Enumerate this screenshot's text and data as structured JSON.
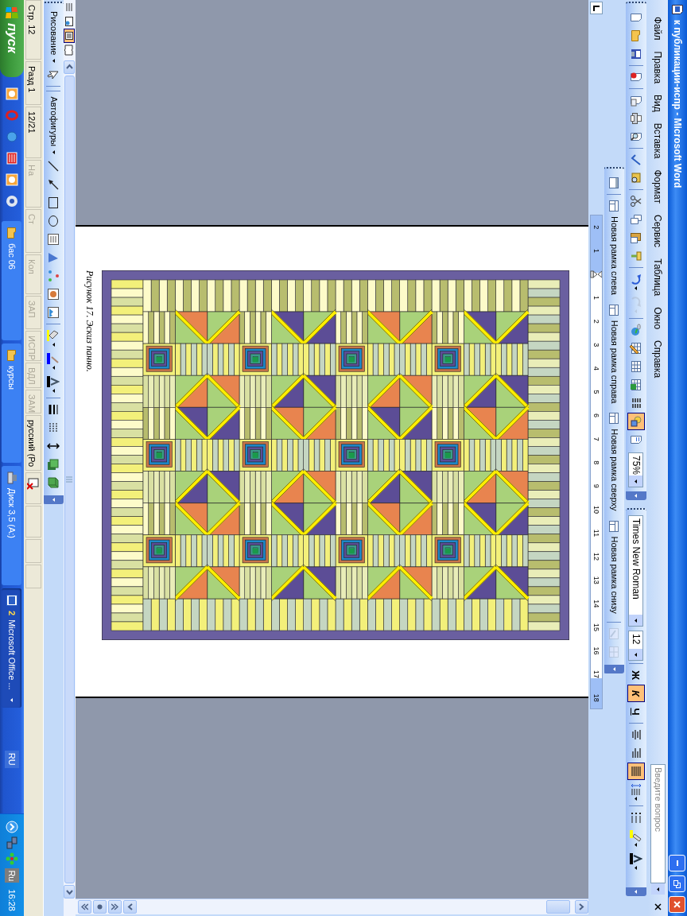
{
  "window": {
    "title": "к публикации-испр - Microsoft Word"
  },
  "menu": [
    "Файл",
    "Правка",
    "Вид",
    "Вставка",
    "Формат",
    "Сервис",
    "Таблица",
    "Окно",
    "Справка"
  ],
  "help": {
    "placeholder": "Введите вопрос"
  },
  "standard_toolbar": {
    "buttons": [
      {
        "kind": "new",
        "selected": false,
        "disabled": false
      },
      {
        "kind": "open",
        "selected": false,
        "disabled": false
      },
      {
        "kind": "save",
        "selected": false,
        "disabled": false
      },
      {
        "kind": "permission",
        "selected": false,
        "disabled": false
      },
      {
        "kind": "email",
        "selected": false,
        "disabled": false
      },
      {
        "kind": "print",
        "selected": false,
        "disabled": false
      },
      {
        "kind": "preview",
        "selected": false,
        "disabled": false
      },
      {
        "kind": "spelling",
        "selected": false,
        "disabled": false
      },
      {
        "kind": "research",
        "selected": false,
        "disabled": false
      },
      {
        "kind": "cut",
        "selected": false,
        "disabled": false
      },
      {
        "kind": "copy",
        "selected": false,
        "disabled": false
      },
      {
        "kind": "paste",
        "selected": false,
        "disabled": false
      },
      {
        "kind": "painter",
        "selected": false,
        "disabled": false
      },
      {
        "kind": "undo",
        "selected": false,
        "disabled": false
      },
      {
        "kind": "redo",
        "selected": false,
        "disabled": true
      },
      {
        "kind": "hyperlink",
        "selected": false,
        "disabled": false
      },
      {
        "kind": "tables-borders",
        "selected": false,
        "disabled": false
      },
      {
        "kind": "table",
        "selected": false,
        "disabled": false
      },
      {
        "kind": "excel",
        "selected": false,
        "disabled": false
      },
      {
        "kind": "columns",
        "selected": false,
        "disabled": false
      },
      {
        "kind": "drawing",
        "selected": true,
        "disabled": false
      },
      {
        "kind": "docmap",
        "selected": false,
        "disabled": false
      }
    ],
    "zoom": "75%"
  },
  "formatting_toolbar": {
    "font": "Times New Roman",
    "size": "12",
    "style_buttons": [
      {
        "label": "Ж",
        "kind": "bold",
        "selected": false
      },
      {
        "label": "К",
        "kind": "italic",
        "selected": true
      },
      {
        "label": "Ч",
        "kind": "underline",
        "selected": false
      }
    ],
    "buttons": [
      {
        "kind": "align-center",
        "selected": false
      },
      {
        "kind": "align-right",
        "selected": false
      },
      {
        "kind": "align-justify",
        "selected": true
      },
      {
        "kind": "line-spacing",
        "selected": false
      },
      {
        "kind": "list",
        "selected": false
      },
      {
        "kind": "highlight",
        "selected": false
      },
      {
        "kind": "font-color",
        "selected": false
      }
    ]
  },
  "frames_toolbar": {
    "items": [
      {
        "kind": "toc",
        "disabled": false
      },
      {
        "kind": "frame",
        "label": "Новая рамка слева",
        "disabled": false
      },
      {
        "kind": "frame",
        "label": "Новая рамка справа",
        "disabled": false
      },
      {
        "kind": "frame",
        "label": "Новая рамка сверху",
        "disabled": false
      },
      {
        "kind": "frame",
        "label": "Новая рамка снизу",
        "disabled": false
      },
      {
        "kind": "properties",
        "disabled": true
      },
      {
        "kind": "delete",
        "disabled": true
      }
    ]
  },
  "ruler": {
    "left_labels": [
      "2",
      "1"
    ],
    "labels": [
      "1",
      "2",
      "3",
      "4",
      "5",
      "6",
      "7",
      "8",
      "9",
      "10",
      "11",
      "12",
      "13",
      "14",
      "15",
      "16",
      "17",
      "18"
    ]
  },
  "document": {
    "caption": "Рисунок 17. Эскиз панно."
  },
  "view_buttons": [
    {
      "kind": "normal",
      "selected": false
    },
    {
      "kind": "web",
      "selected": false
    },
    {
      "kind": "print",
      "selected": true
    },
    {
      "kind": "reading",
      "selected": false
    }
  ],
  "drawing_toolbar": {
    "items": [
      {
        "kind": "menu",
        "label": "Рисование"
      },
      {
        "kind": "select"
      },
      {
        "kind": "menu",
        "label": "Автофигуры"
      },
      {
        "kind": "line"
      },
      {
        "kind": "arrow"
      },
      {
        "kind": "rect"
      },
      {
        "kind": "oval"
      },
      {
        "kind": "textbox"
      },
      {
        "kind": "wordart"
      },
      {
        "kind": "diagram"
      },
      {
        "kind": "clipart"
      },
      {
        "kind": "picture"
      },
      {
        "kind": "fill"
      },
      {
        "kind": "linecolor"
      },
      {
        "kind": "fontcolor"
      },
      {
        "kind": "linestyle"
      },
      {
        "kind": "dashstyle"
      },
      {
        "kind": "arrowstyle"
      },
      {
        "kind": "shadow"
      },
      {
        "kind": "extrusion"
      }
    ]
  },
  "status_bar": {
    "items": [
      {
        "text": "Стр. 12",
        "disabled": false
      },
      {
        "text": "Разд 1",
        "disabled": false
      },
      {
        "text": "12/21",
        "disabled": false
      },
      {
        "text": "На",
        "disabled": true
      },
      {
        "text": "Ст",
        "disabled": true
      },
      {
        "text": "Кол",
        "disabled": true
      },
      {
        "text": "ЗАП",
        "disabled": true
      },
      {
        "text": "ИСПР",
        "disabled": true
      },
      {
        "text": "ВДЛ",
        "disabled": true
      },
      {
        "text": "ЗАМ",
        "disabled": true
      },
      {
        "text": "русский (Ро",
        "disabled": false
      }
    ]
  },
  "taskbar": {
    "start": "пуск",
    "tasks": [
      {
        "kind": "folder",
        "label": "бас 06",
        "selected": false
      },
      {
        "kind": "folder",
        "label": "курсы",
        "selected": false
      },
      {
        "kind": "drive",
        "label": "Диск 3,5 (A:)",
        "selected": false
      },
      {
        "kind": "word",
        "count": "2",
        "label": "Microsoft Office ...",
        "selected": true
      }
    ],
    "tray": {
      "language": "RU",
      "input": "Ru",
      "time": "16:28"
    }
  }
}
